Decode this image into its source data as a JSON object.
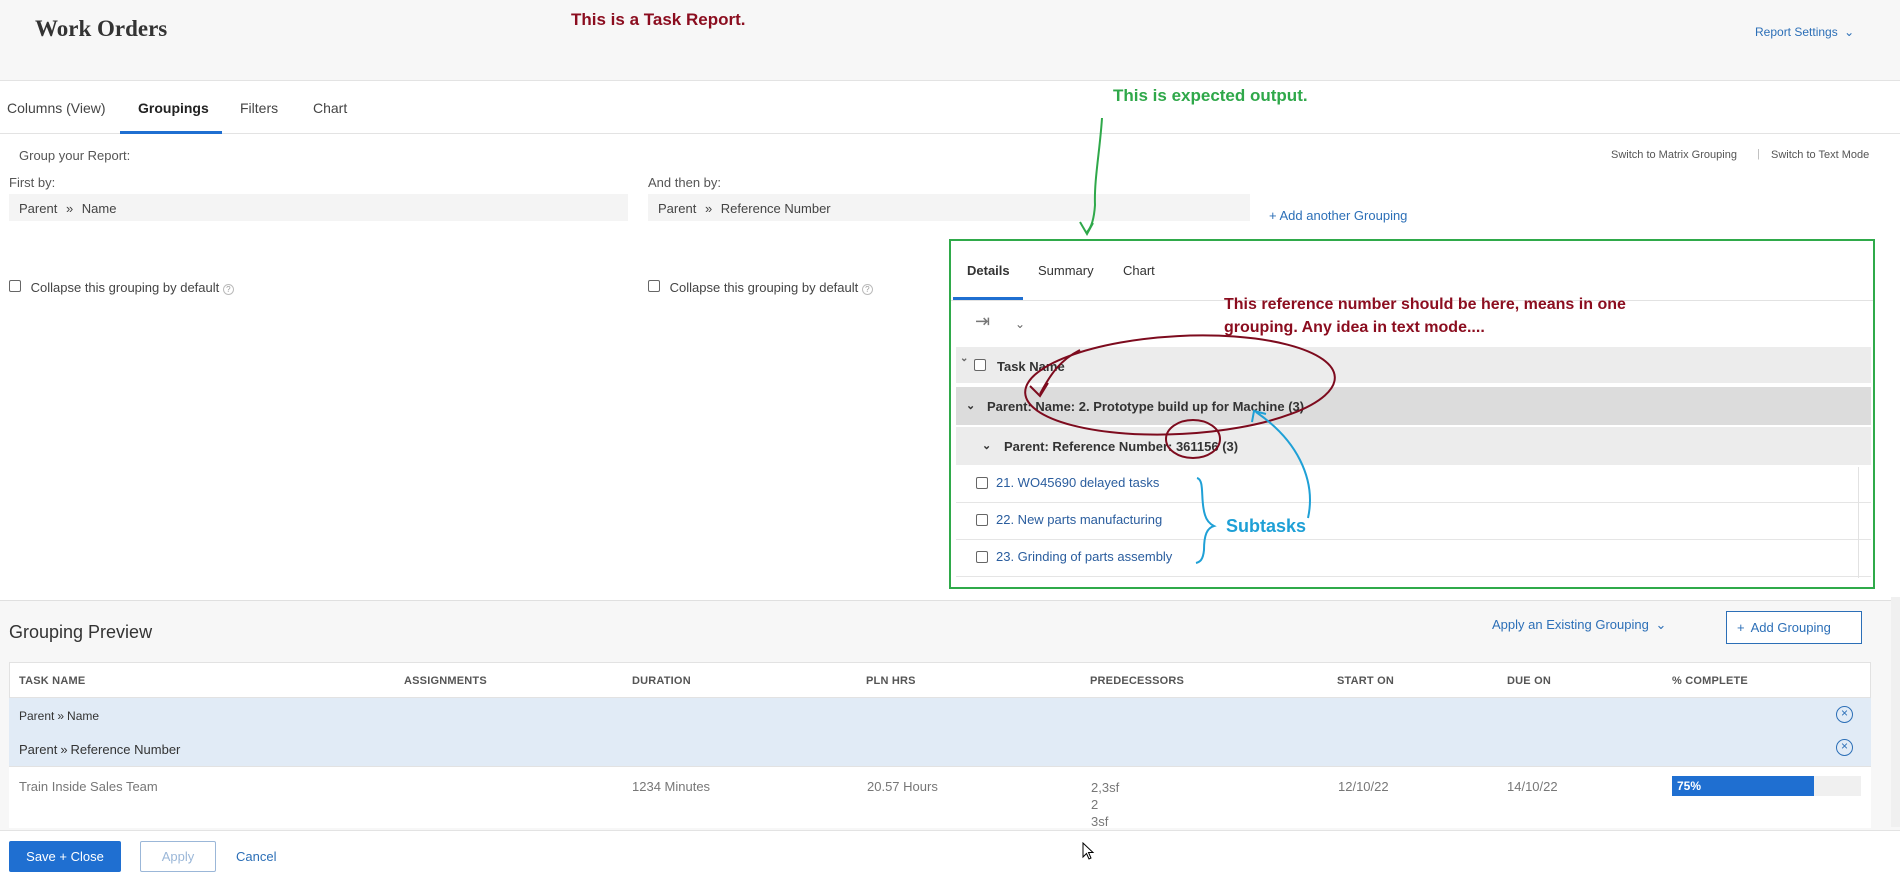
{
  "header": {
    "title": "Work Orders",
    "annotation": "This is a Task Report.",
    "report_settings": "Report Settings"
  },
  "tabs": [
    {
      "label": "Columns (View)"
    },
    {
      "label": "Groupings"
    },
    {
      "label": "Filters"
    },
    {
      "label": "Chart"
    }
  ],
  "grouping": {
    "group_label": "Group your Report:",
    "switch_matrix": "Switch to Matrix Grouping",
    "switch_text": "Switch to Text Mode",
    "first_by_label": "First by:",
    "first_by_value": {
      "part1": "Parent",
      "part2": "Name"
    },
    "then_by_label": "And then by:",
    "then_by_value": {
      "part1": "Parent",
      "part2": "Reference Number"
    },
    "add_another": "+ Add another Grouping",
    "collapse_label": "Collapse this grouping by default"
  },
  "annotations": {
    "expected": "This is expected output.",
    "reference_note_line1": "This reference number should be here, means in one",
    "reference_note_line2": "grouping. Any idea in text mode....",
    "subtasks": "Subtasks"
  },
  "expected_preview": {
    "tabs": [
      "Details",
      "Summary",
      "Chart"
    ],
    "column_header": "Task Name",
    "group1": "Parent: Name: 2. Prototype build up for Machine (3)",
    "group2": "Parent: Reference Number: 361156 (3)",
    "tasks": [
      "21. WO45690 delayed tasks",
      "22. New parts manufacturing",
      "23. Grinding of parts assembly"
    ]
  },
  "preview": {
    "title": "Grouping Preview",
    "apply_existing": "Apply an Existing Grouping",
    "add_grouping": "Add Grouping",
    "columns": [
      "TASK NAME",
      "ASSIGNMENTS",
      "DURATION",
      "PLN HRS",
      "PREDECESSORS",
      "START ON",
      "DUE ON",
      "% COMPLETE"
    ],
    "group1": {
      "part1": "Parent",
      "part2": "Name"
    },
    "group2": {
      "part1": "Parent",
      "part2": "Reference Number"
    },
    "row": {
      "task_name": "Train Inside Sales Team",
      "assignments": "",
      "duration": "1234 Minutes",
      "pln_hrs": "20.57 Hours",
      "predecessors": [
        "2,3sf",
        "2",
        "3sf"
      ],
      "start_on": "12/10/22",
      "due_on": "14/10/22",
      "percent_complete": "75%",
      "percent_value": 0.75
    }
  },
  "footer": {
    "save_close": "Save + Close",
    "apply": "Apply",
    "cancel": "Cancel"
  },
  "colors": {
    "accent": "#1f6fd1",
    "annotation_red": "#8b0d1f",
    "annotation_green": "#2fa84a",
    "annotation_blue": "#1fa0d6"
  }
}
